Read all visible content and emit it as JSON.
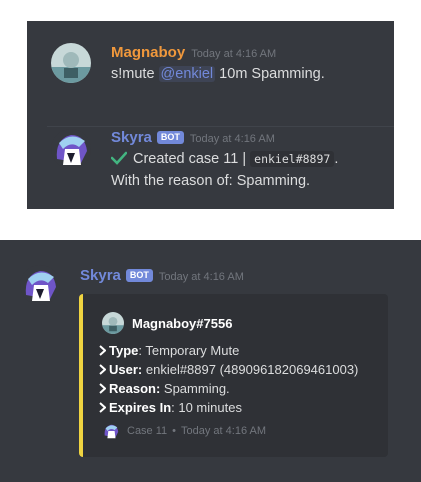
{
  "colors": {
    "background": "#36393f",
    "magnaboy_name": "#f0983c",
    "skyra_name": "#7289da",
    "bot_tag": "#7289da",
    "embed_bar": "#f0d441",
    "check": "#43b581"
  },
  "top": {
    "msg1": {
      "author": "Magnaboy",
      "timestamp": "Today at 4:16 AM",
      "text_prefix": "s!mute ",
      "mention": "@enkiel",
      "text_suffix": " 10m Spamming."
    },
    "msg2": {
      "author": "Skyra",
      "bot_tag": "BOT",
      "timestamp": "Today at 4:16 AM",
      "check_icon": "check-icon",
      "line1_prefix": "Created case 11 | ",
      "line1_code": "enkiel#8897",
      "line1_suffix": ".",
      "line2": "With the reason of: Spamming."
    }
  },
  "bottom": {
    "author": "Skyra",
    "bot_tag": "BOT",
    "timestamp": "Today at 4:16 AM",
    "embed": {
      "author_name": "Magnaboy#7556",
      "fields": [
        {
          "label": "Type",
          "value": ": Temporary Mute"
        },
        {
          "label": "User:",
          "value": " enkiel#8897 (489096182069461003)"
        },
        {
          "label": "Reason:",
          "value": " Spamming."
        },
        {
          "label": "Expires In",
          "value": ": 10 minutes"
        }
      ],
      "footer_text": "Case 11",
      "footer_separator": "•",
      "footer_timestamp": "Today at 4:16 AM"
    }
  }
}
